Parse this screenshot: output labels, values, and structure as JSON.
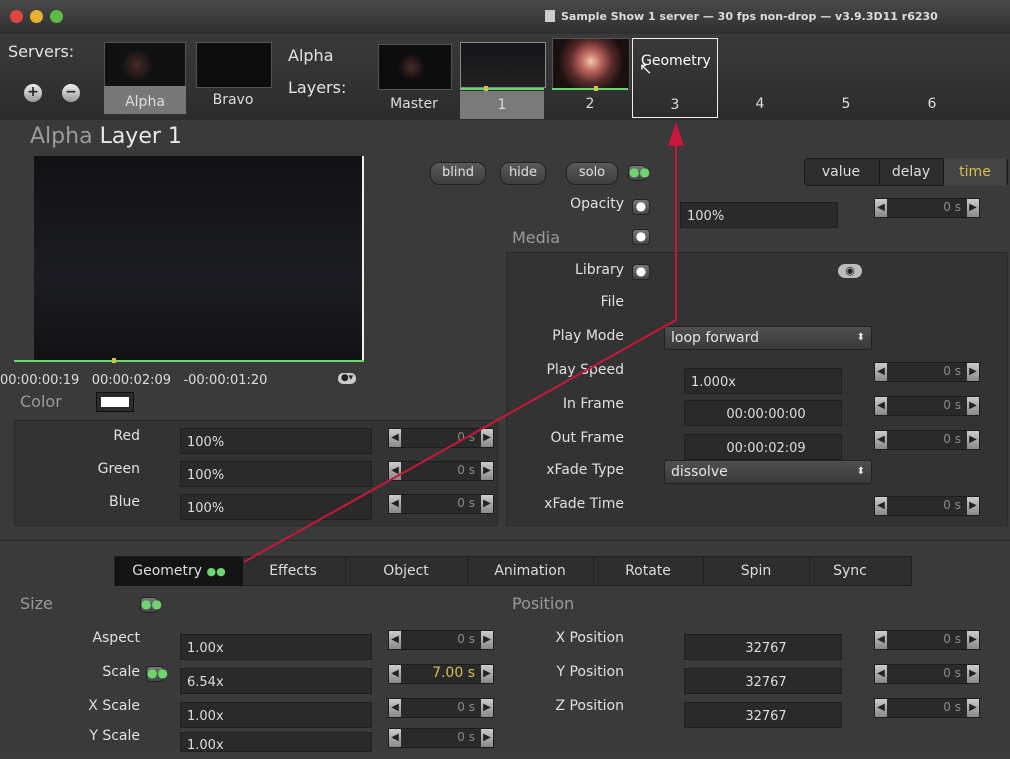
{
  "window": {
    "title": "Sample Show 1 server  —  30 fps non-drop  —  v3.9.3D11 r6230"
  },
  "servers": {
    "label": "Servers:",
    "items": [
      "Alpha",
      "Bravo"
    ]
  },
  "layers": {
    "label_1": "Alpha",
    "label_2": "Layers:",
    "items": [
      "Master",
      "1",
      "2",
      "3",
      "4",
      "5",
      "6"
    ],
    "hover_tooltip": "Geometry"
  },
  "heading": {
    "prefix": "Alpha",
    "name": "Layer 1"
  },
  "preview": {
    "timecode_elapsed": "00:00:00:19",
    "timecode_total": "00:00:02:09",
    "timecode_remaining": "-00:00:01:20"
  },
  "color": {
    "label": "Color",
    "rows": [
      {
        "label": "Red",
        "value": "100%",
        "time": "0 s"
      },
      {
        "label": "Green",
        "value": "100%",
        "time": "0 s"
      },
      {
        "label": "Blue",
        "value": "100%",
        "time": "0 s"
      }
    ]
  },
  "buttons": {
    "blind": "blind",
    "hide": "hide",
    "solo": "solo"
  },
  "mode_tabs": {
    "value": "value",
    "delay": "delay",
    "time": "time"
  },
  "opacity": {
    "label": "Opacity",
    "value": "100%",
    "time": "0 s"
  },
  "media": {
    "label": "Media",
    "library": "Library",
    "file": "File",
    "play_mode_label": "Play Mode",
    "play_mode": "loop forward",
    "play_speed_label": "Play Speed",
    "play_speed": "1.000x",
    "play_speed_time": "0 s",
    "in_frame_label": "In Frame",
    "in_frame": "00:00:00:00",
    "in_frame_time": "0 s",
    "out_frame_label": "Out Frame",
    "out_frame": "00:00:02:09",
    "out_frame_time": "0 s",
    "xfade_type_label": "xFade Type",
    "xfade_type": "dissolve",
    "xfade_time_label": "xFade Time",
    "xfade_time": "0 s"
  },
  "tabs": [
    "Geometry",
    "Effects",
    "Object",
    "Animation",
    "Rotate",
    "Spin",
    "Sync"
  ],
  "size": {
    "label": "Size",
    "rows": [
      {
        "label": "Aspect",
        "value": "1.00x",
        "time": "0 s"
      },
      {
        "label": "Scale",
        "value": "6.54x",
        "time": "7.00 s"
      },
      {
        "label": "X Scale",
        "value": "1.00x",
        "time": "0 s"
      },
      {
        "label": "Y Scale",
        "value": "1.00x",
        "time": "0 s"
      }
    ]
  },
  "position": {
    "label": "Position",
    "rows": [
      {
        "label": "X Position",
        "value": "32767",
        "time": "0 s"
      },
      {
        "label": "Y Position",
        "value": "32767",
        "time": "0 s"
      },
      {
        "label": "Z Position",
        "value": "32767",
        "time": "0 s"
      }
    ]
  },
  "colors": {
    "accent": "#d4c24a",
    "arrow": "#c8173a",
    "green": "#6dd56d"
  }
}
